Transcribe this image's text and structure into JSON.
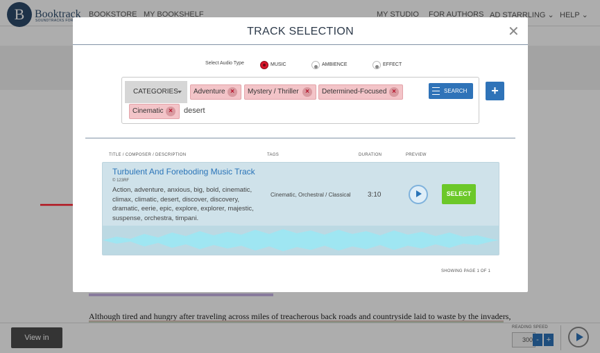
{
  "app": {
    "logo_text": "Booktrack",
    "logo_sub": "SOUNDTRACKS FOR BO",
    "logo_glyph": "B"
  },
  "nav": {
    "bookstore": "BOOKSTORE",
    "bookshelf": "MY BOOKSHELF",
    "studio": "MY STUDIO",
    "authors": "FOR AUTHORS",
    "user": "AD STARRLING",
    "help": "HELP"
  },
  "modal": {
    "title": "TRACK SELECTION",
    "close_glyph": "✕",
    "audio_type_label": "Select Audio Type",
    "audio_types": [
      {
        "label": "MUSIC",
        "selected": true
      },
      {
        "label": "AMBIENCE",
        "selected": false
      },
      {
        "label": "EFFECT",
        "selected": false
      }
    ],
    "categories_label": "CATEGORIES",
    "tags": [
      "Adventure",
      "Mystery / Thriller",
      "Determined-Focused",
      "Cinematic"
    ],
    "search_value": "desert",
    "search_button": "SEARCH",
    "add_glyph": "+",
    "columns": {
      "title": "TITLE / COMPOSER / DESCRIPTION",
      "tags": "TAGS",
      "duration": "DURATION",
      "preview": "PREVIEW"
    },
    "track": {
      "title": "Turbulent And Foreboding Music Track",
      "credit": "© 123RF",
      "description": "Action, adventure, anxious, big, bold, cinematic, climax, climatic, desert, discover, discovery, dramatic, eerie, epic, explore, explorer, majestic, suspense, orchestra, timpani.",
      "tags": "Cinematic, Orchestral / Classical",
      "duration": "3:10",
      "select_label": "SELECT"
    },
    "pagination": "SHOWING PAGE 1 OF 1"
  },
  "reader": {
    "story_text": "Although tired and hungry after traveling across miles of treacherous back roads and countryside laid to waste by the invaders,",
    "view_in_reader": "View in Reader",
    "reading_speed_label": "READING SPEED",
    "reading_speed_value": "300",
    "minus": "-",
    "plus": "+"
  },
  "colors": {
    "accent_blue": "#2f73b8",
    "select_green": "#6cc829",
    "tag_pink": "#f3c4c8",
    "arrow_red": "#b3121d",
    "waveform": "#9fe6f2"
  }
}
